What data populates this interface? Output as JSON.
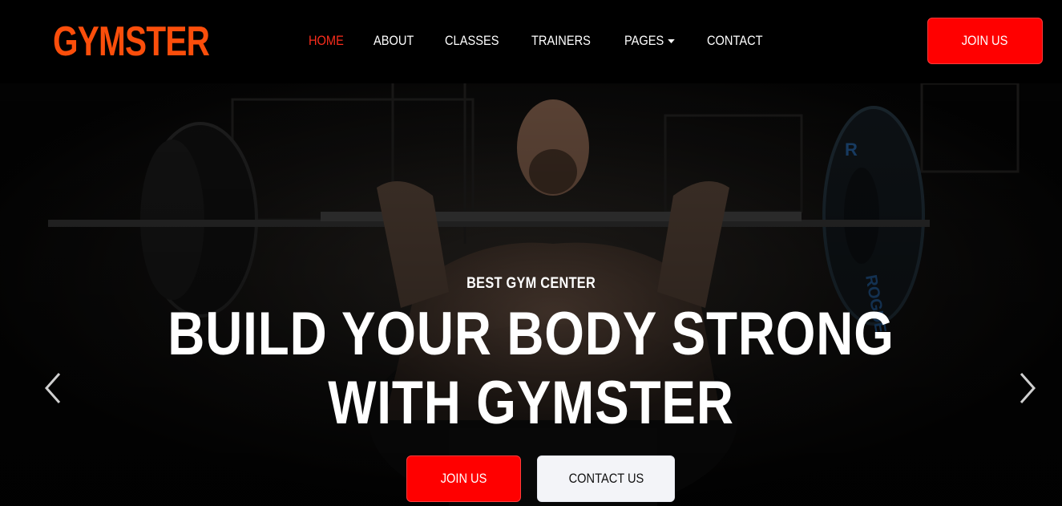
{
  "brand": {
    "name": "GYMSTER",
    "color": "#fb4e0b"
  },
  "nav": {
    "items": [
      {
        "label": "HOME",
        "active": true
      },
      {
        "label": "ABOUT",
        "active": false
      },
      {
        "label": "CLASSES",
        "active": false
      },
      {
        "label": "TRAINERS",
        "active": false
      },
      {
        "label": "PAGES",
        "active": false,
        "has_dropdown": true
      },
      {
        "label": "CONTACT",
        "active": false
      }
    ],
    "join_label": "JOIN US"
  },
  "hero": {
    "eyebrow": "BEST GYM CENTER",
    "headline_line1": "BUILD YOUR BODY STRONG",
    "headline_line2": "WITH GYMSTER",
    "primary_label": "JOIN US",
    "secondary_label": "CONTACT US",
    "prev_icon": "chevron-left-icon",
    "next_icon": "chevron-right-icon"
  },
  "colors": {
    "accent_red": "#ff0000",
    "active_nav": "#fb2d1c",
    "background": "#000000"
  }
}
